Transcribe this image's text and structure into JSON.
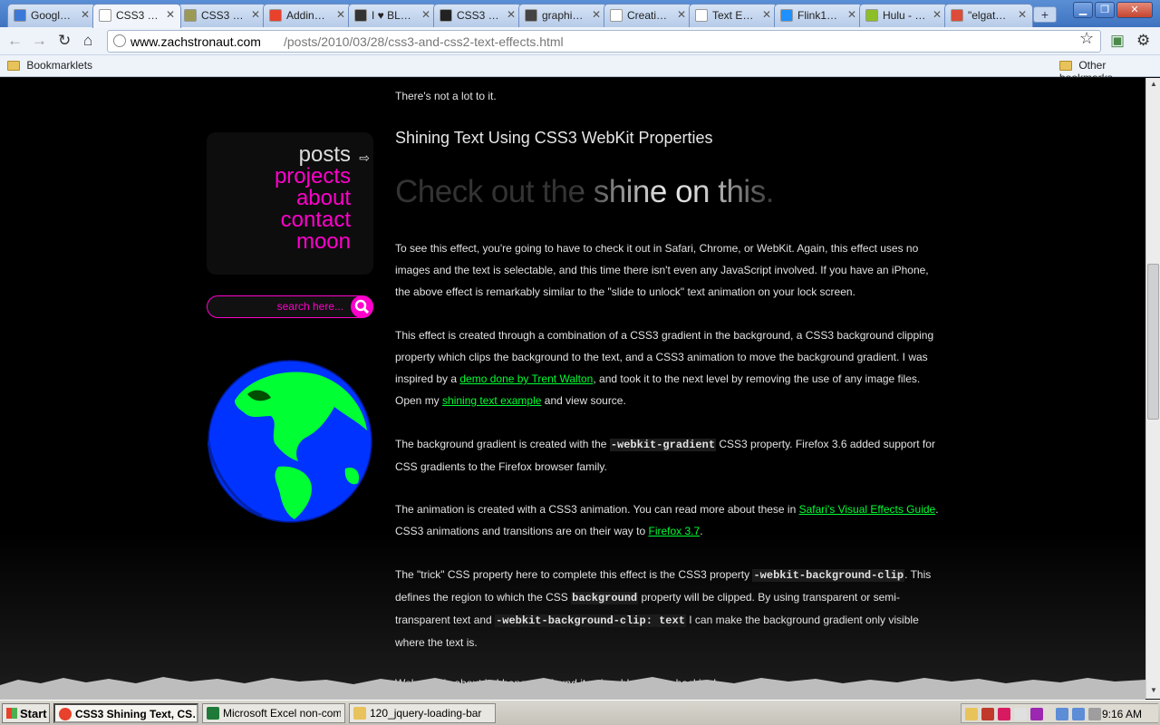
{
  "browser": {
    "tabs": [
      {
        "title": "Googl…",
        "favicon": "google-icon",
        "color": "#3c78d8",
        "active": false
      },
      {
        "title": "CSS3 …",
        "favicon": "page-icon",
        "color": "#ffffff",
        "active": true
      },
      {
        "title": "CSS3 …",
        "favicon": "d-icon",
        "color": "#9a9a55",
        "active": false
      },
      {
        "title": "Addin…",
        "favicon": "asterisk-icon",
        "color": "#e8412c",
        "active": false
      },
      {
        "title": "I ♥ BL…",
        "favicon": "ninja-icon",
        "color": "#333333",
        "active": false
      },
      {
        "title": "CSS3 …",
        "favicon": "logo-icon",
        "color": "#222222",
        "active": false
      },
      {
        "title": "graphi…",
        "favicon": "g-icon",
        "color": "#444444",
        "active": false
      },
      {
        "title": "Creati…",
        "favicon": "page-icon",
        "color": "#ffffff",
        "active": false
      },
      {
        "title": "Text E…",
        "favicon": "page-icon",
        "color": "#ffffff",
        "active": false
      },
      {
        "title": "Flink1…",
        "favicon": "flickr-icon",
        "color": "#1e90ff",
        "active": false
      },
      {
        "title": "Hulu - …",
        "favicon": "hulu-icon",
        "color": "#8cbf26",
        "active": false
      },
      {
        "title": "\"elgat…",
        "favicon": "google-icon",
        "color": "#dd4b39",
        "active": false
      }
    ],
    "url_host": "www.zachstronaut.com",
    "url_path": "/posts/2010/03/28/css3-and-css2-text-effects.html",
    "bookmarks": {
      "left": "Bookmarklets",
      "right": "Other bookmarks"
    }
  },
  "sidebar": {
    "nav": [
      {
        "label": "posts",
        "active": true
      },
      {
        "label": "projects",
        "active": false
      },
      {
        "label": "about",
        "active": false
      },
      {
        "label": "contact",
        "active": false
      },
      {
        "label": "moon",
        "active": false
      }
    ],
    "search_placeholder": "search here...",
    "accent": "#ff00cc"
  },
  "article": {
    "intro_tail": "There's not a lot to it.",
    "heading": "Shining Text Using CSS3 WebKit Properties",
    "shine_demo": "Check out the shine on this.",
    "p1": "To see this effect, you're going to have to check it out in Safari, Chrome, or WebKit. Again, this effect uses no images and the text is selectable, and this time there isn't even any JavaScript involved. If you have an iPhone, the above effect is remarkably similar to the \"slide to unlock\" text animation on your lock screen.",
    "p2": {
      "t1": "This effect is created through a combination of a CSS3 gradient in the background, a CSS3 background clipping property which clips the background to the text, and a CSS3 animation to move the background gradient. I was inspired by a ",
      "link1": "demo done by Trent Walton",
      "t2": ", and took it to the next level by removing the use of any image files. Open my ",
      "link2": "shining text example",
      "t3": " and view source."
    },
    "p3": {
      "t1": "The background gradient is created with the ",
      "code1": "-webkit-gradient",
      "t2": " CSS3 property. Firefox 3.6 added support for CSS gradients to the Firefox browser family."
    },
    "p4": {
      "t1": "The animation is created with a CSS3 animation. You can read more about these in ",
      "link1": "Safari's Visual Effects Guide",
      "t2": ". CSS3 animations and transitions are on their way to ",
      "link2": "Firefox 3.7",
      "t3": "."
    },
    "p5": {
      "t1": "The \"trick\" CSS property here to complete this effect is the CSS3 property ",
      "code1": "-webkit-background-clip",
      "t2": ". This defines the region to which the CSS ",
      "code2": "background",
      "t3": " property will be clipped. By using transparent or semi-transparent text and ",
      "code3": "-webkit-background-clip: text",
      "t4": " I can make the background gradient only visible where the text is."
    },
    "p6": "Welp, that's about it. I hope you found it enjoyable. Happy hacking!",
    "link_color": "#00ff33"
  },
  "taskbar": {
    "start": "Start",
    "tasks": [
      {
        "label": "CSS3 Shining Text, CS…",
        "icon": "chrome-icon",
        "active": true
      },
      {
        "label": "Microsoft Excel non-com…",
        "icon": "excel-icon",
        "active": false
      },
      {
        "label": "120_jquery-loading-bar",
        "icon": "folder-icon",
        "active": false
      }
    ],
    "clock": "9:16 AM"
  }
}
